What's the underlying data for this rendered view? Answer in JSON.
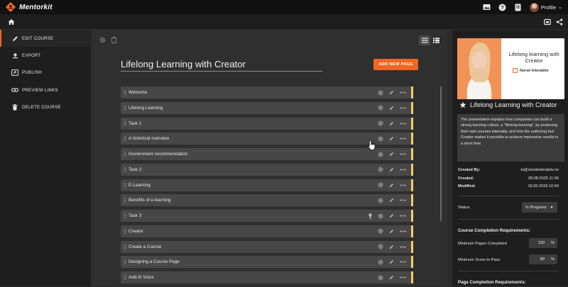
{
  "app": {
    "name": "Mentorkit"
  },
  "topbar": {
    "profile_label": "Profile"
  },
  "sidebar": {
    "items": [
      {
        "label": "EDIT COURSE",
        "icon": "pencil-icon",
        "active": true
      },
      {
        "label": "EXPORT",
        "icon": "export-icon"
      },
      {
        "label": "PUBLISH",
        "icon": "publish-icon"
      },
      {
        "label": "PREVIEW LINKS",
        "icon": "link-icon"
      },
      {
        "label": "DELETE COURSE",
        "icon": "trash-icon"
      }
    ]
  },
  "editor": {
    "course_title": "Lifelong Learning with Creator",
    "add_page_label": "ADD NEW PAGE",
    "pages": [
      {
        "name": "Welcome"
      },
      {
        "name": "Lifelong Learning"
      },
      {
        "name": "Task 1"
      },
      {
        "name": "A historical overview"
      },
      {
        "name": "Government recommendation"
      },
      {
        "name": "Task 2"
      },
      {
        "name": "E-Learning"
      },
      {
        "name": "Benefits of e-learning"
      },
      {
        "name": "Task 3",
        "has_trophy": true
      },
      {
        "name": "Creator"
      },
      {
        "name": "Create a Course"
      },
      {
        "name": "Designing a Course Page"
      },
      {
        "name": "Add AI Voice"
      }
    ]
  },
  "details": {
    "thumbnail": {
      "title": "Lifelong learning with Creator",
      "brand": "Norsk Interaktiv"
    },
    "title": "Lifelong Learning with Creator",
    "description": "The presentation explains how companies can build a strong learning culture, a \"lifelong learning\", by producing their own courses internally, and how the authoring tool Creator makes it possible to achieve impressive results in a short time.",
    "created_by_label": "Created By:",
    "created_by": "ts@norskinteraktiv.no",
    "created_label": "Created:",
    "created": "28.08.2025 11:06",
    "modified_label": "Modified:",
    "modified": "19.05.2026 10:43",
    "status_label": "Status",
    "status_value": "In Progress",
    "course_req_heading": "Course Completion Requirements:",
    "min_pages_label": "Minimum Pages Completed",
    "min_pages_value": "100",
    "min_score_label": "Minimum Score to Pass",
    "min_score_value": "80",
    "percent_unit": "%",
    "page_req_heading": "Page Completion Requirements:"
  },
  "colors": {
    "accent": "#f26522",
    "row_marker": "#f3cf6a"
  }
}
